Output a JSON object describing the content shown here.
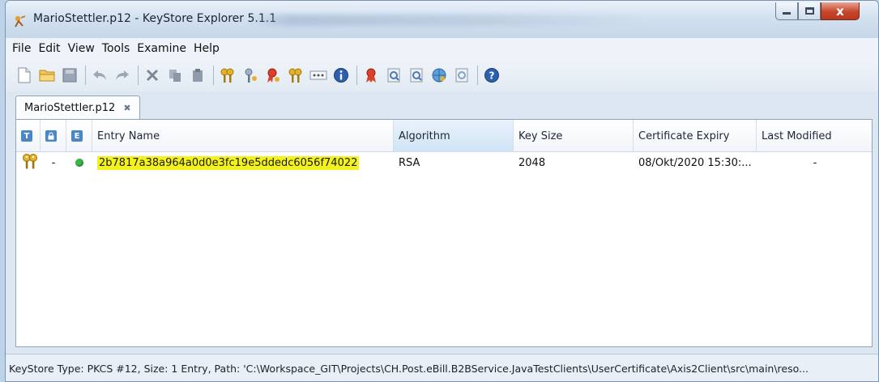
{
  "window": {
    "title": "MarioStettler.p12 - KeyStore Explorer 5.1.1",
    "controls": {
      "minimize": "minimize",
      "maximize": "maximize",
      "close": "x"
    }
  },
  "menubar": [
    "File",
    "Edit",
    "View",
    "Tools",
    "Examine",
    "Help"
  ],
  "toolbar_icons": [
    "new-file-icon",
    "open-folder-icon",
    "save-icon",
    "undo-icon",
    "redo-icon",
    "cut-icon",
    "copy-icon",
    "paste-icon",
    "generate-keypair-icon",
    "generate-secret-key-icon",
    "import-trusted-cert-icon",
    "import-keypair-icon",
    "set-password-icon",
    "properties-icon",
    "examine-file-icon",
    "examine-clipboard-icon",
    "examine-ssl-icon",
    "examine-crl-icon",
    "examine-csr-icon",
    "help-icon"
  ],
  "tab": {
    "label": "MarioStettler.p12",
    "close": "✖"
  },
  "table": {
    "header_badges": {
      "type": "T",
      "lock": "",
      "expiry": "E"
    },
    "columns": [
      "Entry Name",
      "Algorithm",
      "Key Size",
      "Certificate Expiry",
      "Last Modified"
    ],
    "sorted_column": "Algorithm",
    "rows": [
      {
        "type_icon": "key-pair-icon",
        "lock": "-",
        "expiry_status": "valid",
        "expiry_color": "#3cb54a",
        "entry_name": "2b7817a38a964a0d0e3fc19e5ddedc6056f74022",
        "algorithm": "RSA",
        "key_size": "2048",
        "certificate_expiry": "08/Okt/2020 15:30:...",
        "last_modified": "-"
      }
    ]
  },
  "status": "KeyStore Type: PKCS #12, Size: 1 Entry, Path: 'C:\\Workspace_GIT\\Projects\\CH.Post.eBill.B2BService.JavaTestClients\\UserCertificate\\Axis2Client\\src\\main\\reso...",
  "colors": {
    "highlight": "#f4f21c",
    "header_badge_blue": "#4a86c8",
    "close_button": "#c8452a"
  }
}
